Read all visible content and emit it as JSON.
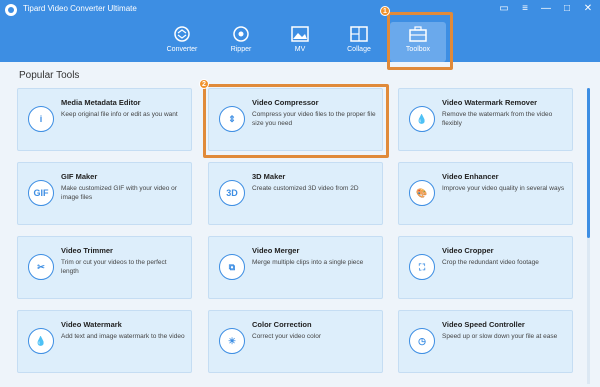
{
  "app": {
    "title": "Tipard Video Converter Ultimate"
  },
  "window_controls": [
    "▭",
    "≡",
    "—",
    "□",
    "✕"
  ],
  "nav": [
    {
      "label": "Converter"
    },
    {
      "label": "Ripper"
    },
    {
      "label": "MV"
    },
    {
      "label": "Collage"
    },
    {
      "label": "Toolbox"
    }
  ],
  "steps": [
    "1",
    "2"
  ],
  "section": {
    "title": "Popular Tools"
  },
  "tools": [
    {
      "icon_text": "i",
      "title": "Media Metadata Editor",
      "desc": "Keep original file info or edit as you want"
    },
    {
      "icon_text": "⇕",
      "title": "Video Compressor",
      "desc": "Compress your video files to the proper file size you need"
    },
    {
      "icon_text": "💧",
      "title": "Video Watermark Remover",
      "desc": "Remove the watermark from the video flexibly"
    },
    {
      "icon_text": "GIF",
      "title": "GIF Maker",
      "desc": "Make customized GIF with your video or image files"
    },
    {
      "icon_text": "3D",
      "title": "3D Maker",
      "desc": "Create customized 3D video from 2D"
    },
    {
      "icon_text": "🎨",
      "title": "Video Enhancer",
      "desc": "Improve your video quality in several ways"
    },
    {
      "icon_text": "✂",
      "title": "Video Trimmer",
      "desc": "Trim or cut your videos to the perfect length"
    },
    {
      "icon_text": "⧉",
      "title": "Video Merger",
      "desc": "Merge multiple clips into a single piece"
    },
    {
      "icon_text": "⛶",
      "title": "Video Cropper",
      "desc": "Crop the redundant video footage"
    },
    {
      "icon_text": "💧",
      "title": "Video Watermark",
      "desc": "Add text and image watermark to the video"
    },
    {
      "icon_text": "☀",
      "title": "Color Correction",
      "desc": "Correct your video color"
    },
    {
      "icon_text": "◷",
      "title": "Video Speed Controller",
      "desc": "Speed up or slow down your file at ease"
    }
  ],
  "colors": {
    "header": "#3d8ee3",
    "highlight": "#e08a3a",
    "accent": "#3d8ee3"
  }
}
